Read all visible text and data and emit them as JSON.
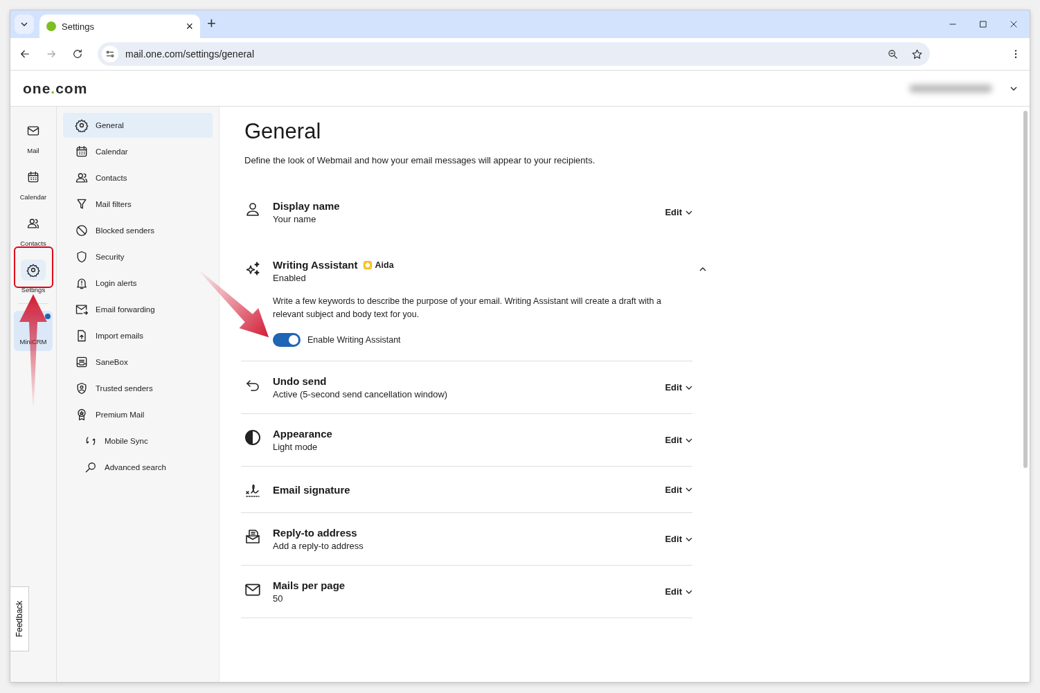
{
  "browser": {
    "tabs": [
      {
        "title": "Settings",
        "selected": true
      }
    ],
    "close_tab": "×",
    "new_tab": "+",
    "address": "mail.one.com/settings/general"
  },
  "header": {
    "logo_left": "one",
    "logo_dot": ".",
    "logo_right": "com"
  },
  "rail": [
    {
      "label": "Mail",
      "kind": "app",
      "selected": false,
      "notification": false
    },
    {
      "label": "Calendar",
      "kind": "app",
      "selected": false,
      "notification": false
    },
    {
      "label": "Contacts",
      "kind": "app",
      "selected": false,
      "notification": false
    },
    {
      "label": "Settings",
      "kind": "app",
      "selected": true,
      "notification": false
    },
    {
      "label": "MiniCRM",
      "kind": "tile",
      "selected": false,
      "notification": true
    }
  ],
  "feedback": "Feedback",
  "nav": [
    {
      "label": "General",
      "kind": "main",
      "selected": true
    },
    {
      "label": "Calendar",
      "kind": "main",
      "selected": false
    },
    {
      "label": "Contacts",
      "kind": "main",
      "selected": false
    },
    {
      "label": "Mail filters",
      "kind": "main",
      "selected": false
    },
    {
      "label": "Blocked senders",
      "kind": "main",
      "selected": false
    },
    {
      "label": "Security",
      "kind": "main",
      "selected": false
    },
    {
      "label": "Login alerts",
      "kind": "main",
      "selected": false
    },
    {
      "label": "Email forwarding",
      "kind": "main",
      "selected": false
    },
    {
      "label": "Import emails",
      "kind": "main",
      "selected": false
    },
    {
      "label": "SaneBox",
      "kind": "main",
      "selected": false
    },
    {
      "label": "Trusted senders",
      "kind": "main",
      "selected": false
    },
    {
      "label": "Premium Mail",
      "kind": "main",
      "selected": false
    },
    {
      "label": "Mobile Sync",
      "kind": "sub",
      "selected": false
    },
    {
      "label": "Advanced search",
      "kind": "sub",
      "selected": false
    }
  ],
  "page": {
    "title": "General",
    "description": "Define the look of Webmail and how your email messages will appear to your recipients.",
    "sections": [
      {
        "kind": "edit",
        "title": "Display name",
        "value": "Your name",
        "action": "Edit"
      },
      {
        "kind": "expandable",
        "title": "Writing Assistant",
        "badge": "Aida",
        "value": "Enabled",
        "expanded": true,
        "description": "Write a few keywords to describe the purpose of your email. Writing Assistant will create a draft with a relevant subject and body text for you.",
        "toggle": {
          "label": "Enable Writing Assistant",
          "on": true
        }
      },
      {
        "kind": "edit",
        "title": "Undo send",
        "value": "Active (5-second send cancellation window)",
        "action": "Edit"
      },
      {
        "kind": "edit",
        "title": "Appearance",
        "value": "Light mode",
        "action": "Edit"
      },
      {
        "kind": "edit",
        "title": "Email signature",
        "action": "Edit"
      },
      {
        "kind": "edit",
        "title": "Reply-to address",
        "value": "Add a reply-to address",
        "action": "Edit"
      },
      {
        "kind": "edit",
        "title": "Mails per page",
        "value": "50",
        "action": "Edit"
      }
    ]
  }
}
